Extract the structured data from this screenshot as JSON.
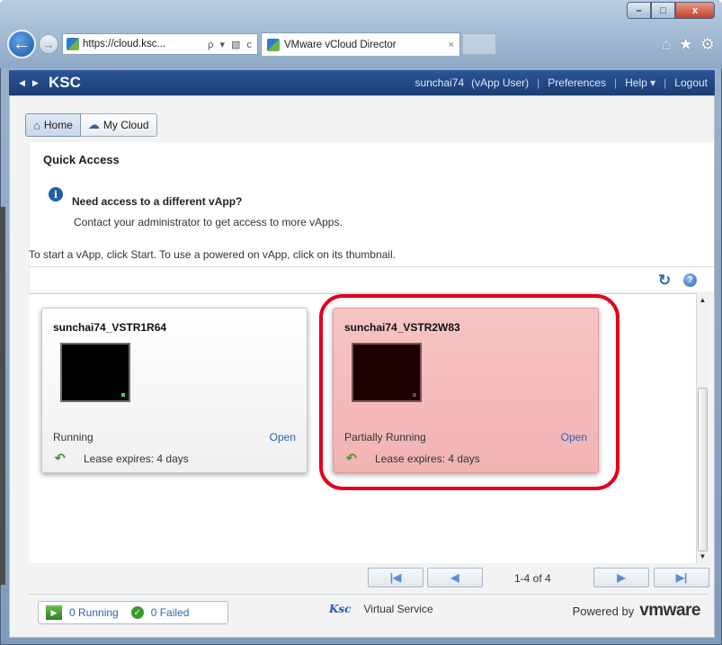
{
  "browser": {
    "address": "https://cloud.ksc...",
    "address_tools": "ρ ▾ ▧ c",
    "tab_title": "VMware vCloud Director",
    "tab_close": "×",
    "window_controls": {
      "minimize": "–",
      "maximize": "□",
      "close": "x"
    }
  },
  "header": {
    "org": "KSC",
    "user": "sunchai74",
    "role": "(vApp User)",
    "preferences": "Preferences",
    "help": "Help ▾",
    "logout": "Logout",
    "separator": "|"
  },
  "tabs": [
    {
      "label": "Home"
    },
    {
      "label": "My Cloud"
    }
  ],
  "quick_access": {
    "title": "Quick Access",
    "need_access": "Need access to a different vApp?",
    "contact": "Contact your administrator to get access to more vApps.",
    "hint": "To start a vApp, click Start. To use a powered on vApp, click on its thumbnail."
  },
  "vapps": [
    {
      "name": "sunchai74_VSTR1R64",
      "status": "Running",
      "open": "Open",
      "lease": "Lease expires: 4 days"
    },
    {
      "name": "sunchai74_VSTR2W83",
      "status": "Partially Running",
      "open": "Open",
      "lease": "Lease expires: 4 days"
    }
  ],
  "pager": {
    "count": "1-4 of 4"
  },
  "footer": {
    "running": "0 Running",
    "failed": "0 Failed",
    "service": "Virtual Service",
    "powered_by": "Powered by",
    "vmware_logo_text": "vmware",
    "ksc_logo_text": "Ksc"
  },
  "colors": {
    "header_blue": "#1c3d73",
    "highlight": "#e3001b",
    "selected_card": "#f2b3b3",
    "link": "#2a64b3"
  }
}
